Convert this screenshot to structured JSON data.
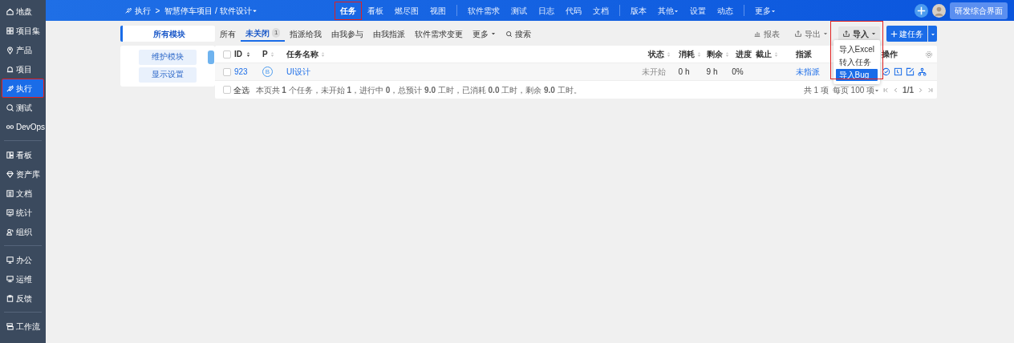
{
  "sidebar": {
    "groups": [
      [
        {
          "label": "地盘",
          "selected": false,
          "highlighted": false
        },
        {
          "label": "项目集",
          "selected": false,
          "highlighted": false
        },
        {
          "label": "产品",
          "selected": false,
          "highlighted": false
        },
        {
          "label": "项目",
          "selected": false,
          "highlighted": false
        },
        {
          "label": "执行",
          "selected": true,
          "highlighted": true
        },
        {
          "label": "测试",
          "selected": false,
          "highlighted": false
        },
        {
          "label": "DevOps",
          "selected": false,
          "highlighted": false
        }
      ],
      [
        {
          "label": "看板",
          "selected": false,
          "highlighted": false
        },
        {
          "label": "资产库",
          "selected": false,
          "highlighted": false
        },
        {
          "label": "文档",
          "selected": false,
          "highlighted": false
        },
        {
          "label": "统计",
          "selected": false,
          "highlighted": false
        },
        {
          "label": "组织",
          "selected": false,
          "highlighted": false
        }
      ],
      [
        {
          "label": "办公",
          "selected": false,
          "highlighted": false
        },
        {
          "label": "运维",
          "selected": false,
          "highlighted": false
        },
        {
          "label": "反馈",
          "selected": false,
          "highlighted": false
        }
      ],
      [
        {
          "label": "工作流",
          "selected": false,
          "highlighted": false
        }
      ]
    ]
  },
  "header": {
    "breadcrumb": {
      "section": "执行",
      "separator": ">",
      "project": "智慧停车项目 / 软件设计"
    },
    "nav_groups": [
      [
        {
          "label": "任务",
          "selected": true,
          "highlighted": true,
          "dropdown": false
        },
        {
          "label": "看板",
          "selected": false,
          "highlighted": false,
          "dropdown": false
        },
        {
          "label": "燃尽图",
          "selected": false,
          "highlighted": false,
          "dropdown": false
        },
        {
          "label": "视图",
          "selected": false,
          "highlighted": false,
          "dropdown": false
        }
      ],
      [
        {
          "label": "软件需求",
          "selected": false,
          "highlighted": false,
          "dropdown": false
        },
        {
          "label": "测试",
          "selected": false,
          "highlighted": false,
          "dropdown": false
        },
        {
          "label": "日志",
          "selected": false,
          "highlighted": false,
          "dropdown": false
        },
        {
          "label": "代码",
          "selected": false,
          "highlighted": false,
          "dropdown": false
        },
        {
          "label": "文档",
          "selected": false,
          "highlighted": false,
          "dropdown": false
        }
      ],
      [
        {
          "label": "版本",
          "selected": false,
          "highlighted": false,
          "dropdown": false
        },
        {
          "label": "其他",
          "selected": false,
          "highlighted": false,
          "dropdown": true
        },
        {
          "label": "设置",
          "selected": false,
          "highlighted": false,
          "dropdown": false
        },
        {
          "label": "动态",
          "selected": false,
          "highlighted": false,
          "dropdown": false
        }
      ],
      [
        {
          "label": "更多",
          "selected": false,
          "highlighted": false,
          "dropdown": true
        }
      ]
    ],
    "workspace_button": "研发综合界面"
  },
  "module_panel": {
    "title": "所有模块",
    "buttons": [
      "维护模块",
      "显示设置"
    ]
  },
  "filters": [
    {
      "label": "所有",
      "selected": false,
      "dropdown": false
    },
    {
      "label": "未关闭",
      "selected": true,
      "count": "1",
      "dropdown": false
    },
    {
      "label": "指派给我",
      "selected": false,
      "dropdown": false
    },
    {
      "label": "由我参与",
      "selected": false,
      "dropdown": false
    },
    {
      "label": "由我指派",
      "selected": false,
      "dropdown": false
    },
    {
      "label": "软件需求变更",
      "selected": false,
      "dropdown": false
    },
    {
      "label": "更多",
      "selected": false,
      "dropdown": true
    }
  ],
  "search_label": "搜索",
  "toolbar": {
    "report": "报表",
    "export": "导出",
    "import": "导入",
    "create": "建任务"
  },
  "import_menu": {
    "highlighted": true,
    "items": [
      {
        "label": "导入Excel",
        "selected": false
      },
      {
        "label": "转入任务",
        "selected": false
      },
      {
        "label": "导入Bug",
        "selected": true
      }
    ]
  },
  "table": {
    "header_checked": false,
    "columns": [
      {
        "label": "ID",
        "sortable": true
      },
      {
        "label": "P",
        "sortable": true
      },
      {
        "label": "任务名称",
        "sortable": true
      },
      {
        "label": "状态",
        "sortable": true
      },
      {
        "label": "消耗",
        "sortable": true
      },
      {
        "label": "剩余",
        "sortable": true
      },
      {
        "label": "进度",
        "sortable": false
      },
      {
        "label": "截止",
        "sortable": true
      },
      {
        "label": "指派",
        "sortable": false
      },
      {
        "label": "操作",
        "sortable": false
      }
    ],
    "rows": [
      {
        "checked": false,
        "id": "923",
        "priority": "B",
        "name": "UI设计",
        "status": "未开始",
        "consumed": "0 h",
        "left": "9 h",
        "progress": "0%",
        "assigned": "未指派"
      }
    ],
    "select_all": {
      "label": "全选",
      "checked": false
    },
    "summary": "本页共 **1** 个任务，未开始 **1**，进行中 **0**，总预计 **9.0** 工时，已消耗 **0.0** 工时，剩余 **9.0** 工时。",
    "pager": {
      "total": "共 1 项",
      "per_page": "每页 100 项",
      "page": "1/1"
    }
  }
}
